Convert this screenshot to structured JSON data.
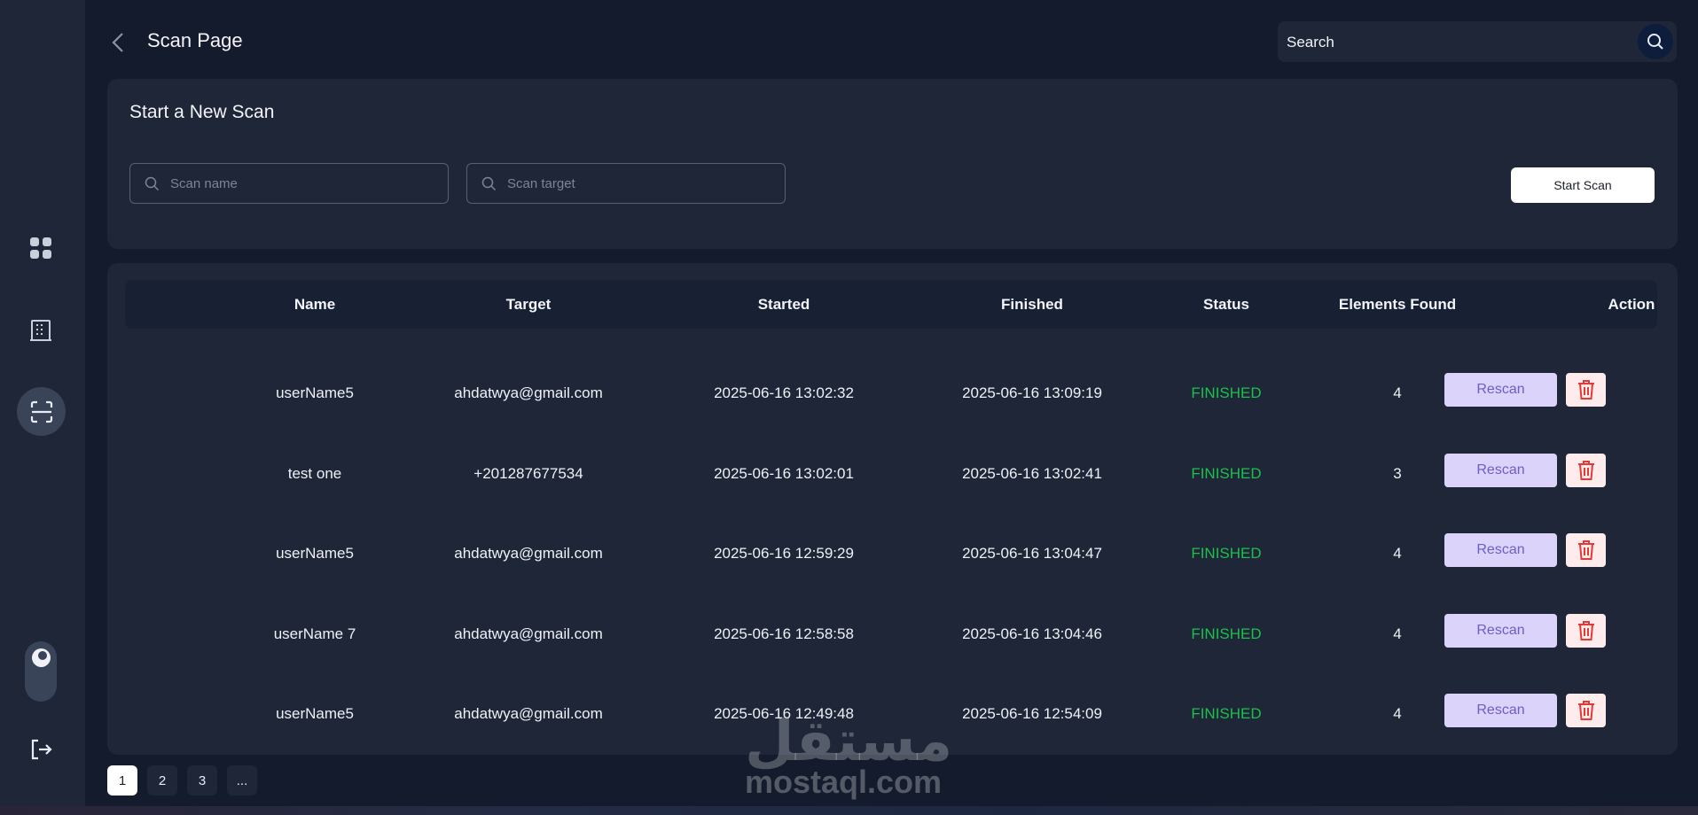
{
  "header": {
    "title": "Scan Page",
    "search_label": "Search"
  },
  "new_scan": {
    "title": "Start a New Scan",
    "name_placeholder": "Scan name",
    "target_placeholder": "Scan target",
    "start_label": "Start Scan"
  },
  "table": {
    "columns": [
      "Name",
      "Target",
      "Started",
      "Finished",
      "Status",
      "Elements Found",
      "Action"
    ],
    "rows": [
      {
        "name": "userName5",
        "target": "ahdatwya@gmail.com",
        "started": "2025-06-16 13:02:32",
        "finished": "2025-06-16 13:09:19",
        "status": "FINISHED",
        "elements": "4",
        "action": "Rescan"
      },
      {
        "name": "test one",
        "target": "+201287677534",
        "started": "2025-06-16 13:02:01",
        "finished": "2025-06-16 13:02:41",
        "status": "FINISHED",
        "elements": "3",
        "action": "Rescan"
      },
      {
        "name": "userName5",
        "target": "ahdatwya@gmail.com",
        "started": "2025-06-16 12:59:29",
        "finished": "2025-06-16 13:04:47",
        "status": "FINISHED",
        "elements": "4",
        "action": "Rescan"
      },
      {
        "name": "userName 7",
        "target": "ahdatwya@gmail.com",
        "started": "2025-06-16 12:58:58",
        "finished": "2025-06-16 13:04:46",
        "status": "FINISHED",
        "elements": "4",
        "action": "Rescan"
      },
      {
        "name": "userName5",
        "target": "ahdatwya@gmail.com",
        "started": "2025-06-16 12:49:48",
        "finished": "2025-06-16 12:54:09",
        "status": "FINISHED",
        "elements": "4",
        "action": "Rescan"
      }
    ]
  },
  "pagination": {
    "pages": [
      "1",
      "2",
      "3",
      "..."
    ],
    "current": "1"
  },
  "sidebar": {
    "icons": [
      "dashboard-icon",
      "building-icon",
      "scan-icon",
      "theme-toggle",
      "logout-icon"
    ],
    "active": "scan-icon"
  },
  "watermark": {
    "arabic": "مستقل",
    "latin": "mostaql.com"
  },
  "colors": {
    "background": "#141b2d",
    "card": "#1e2638",
    "status_finished": "#1fbf4c",
    "rescan_bg": "#dcd3fb",
    "rescan_text": "#6b5fc5",
    "delete_icon": "#e53935"
  }
}
